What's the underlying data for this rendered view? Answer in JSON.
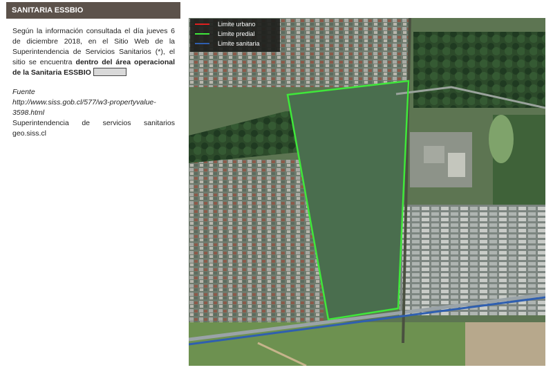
{
  "header": {
    "title": "SANITARIA ESSBIO"
  },
  "body": {
    "paragraph_plain": "Según la información consultada el día jueves 6 de diciembre 2018, en el Sitio Web de la Superintendencia de Servicios Sanitarios (*), el sitio se encuentra ",
    "paragraph_bold": "dentro del área operacional de la Sanitaria ESSBIO"
  },
  "source": {
    "label": "Fuente",
    "url_line1": "http://www.siss.gob.cl/577/w3-propertyvalue-",
    "url_line2": "3598.html",
    "org_words": [
      "Superintendencia",
      "de",
      "servicios",
      "sanitarios"
    ],
    "site": "geo.siss.cl"
  },
  "map": {
    "legend": [
      {
        "label": "Limite urbano",
        "color": "#e0201f"
      },
      {
        "label": "Limite predial",
        "color": "#3fe83a"
      },
      {
        "label": "Limite sanitaria",
        "color": "#2f5fb0"
      }
    ]
  }
}
